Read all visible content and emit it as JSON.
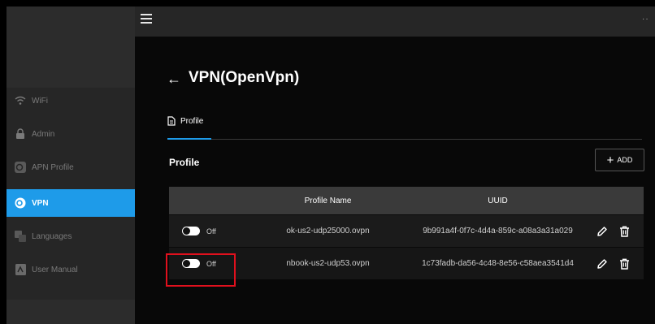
{
  "header": {
    "menu_icon": "hamburger-icon",
    "more_icon": "more-icon",
    "more_text": "··"
  },
  "sidebar": {
    "items": [
      {
        "label": "WiFi",
        "icon": "wifi-icon"
      },
      {
        "label": "Admin",
        "icon": "lock-icon"
      },
      {
        "label": "APN Profile",
        "icon": "apn-icon"
      },
      {
        "label": "VPN",
        "icon": "vpn-icon",
        "active": true
      },
      {
        "label": "Languages",
        "icon": "languages-icon"
      },
      {
        "label": "User Manual",
        "icon": "manual-icon"
      }
    ]
  },
  "page": {
    "back_arrow": "←",
    "title": "VPN(OpenVpn)",
    "tab_label": "Profile",
    "section_title": "Profile",
    "add_plus": "+",
    "add_label": "ADD"
  },
  "table": {
    "headers": {
      "name": "Profile Name",
      "uuid": "UUID"
    },
    "rows": [
      {
        "toggle_state": "Off",
        "name": "ok-us2-udp25000.ovpn",
        "uuid": "9b991a4f-0f7c-4d4a-859c-a08a3a31a029"
      },
      {
        "toggle_state": "Off",
        "name": "nbook-us2-udp53.ovpn",
        "uuid": "1c73fadb-da56-4c48-8e56-c58aea3541d4"
      }
    ]
  },
  "colors": {
    "accent": "#1e9be9",
    "highlight": "#e0101d",
    "sidebar_bg": "#262626"
  }
}
